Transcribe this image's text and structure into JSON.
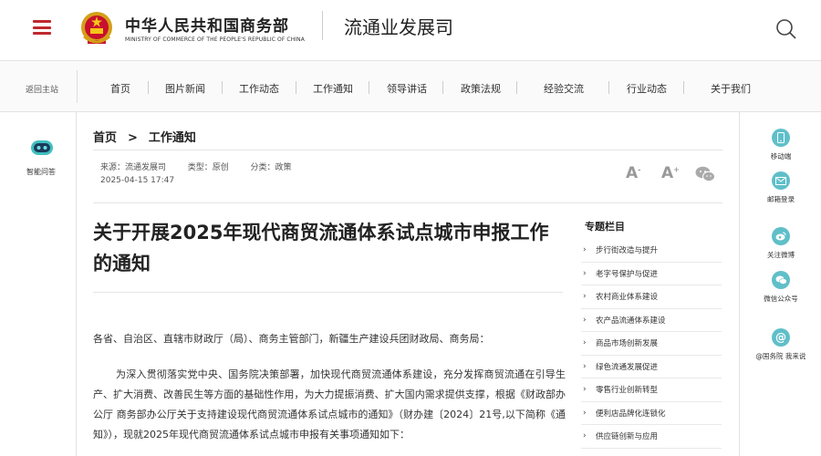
{
  "header": {
    "ministry_cn": "中华人民共和国商务部",
    "ministry_en": "MINISTRY OF COMMERCE OF THE PEOPLE'S REPUBLIC OF CHINA",
    "department": "流通业发展司",
    "icons": {
      "menu": "hamburger-menu-icon",
      "emblem": "national-emblem-icon",
      "search": "search-icon"
    },
    "accent_color": "#c0282e"
  },
  "nav": {
    "home": "返回主站",
    "items": [
      "首页",
      "图片新闻",
      "工作动态",
      "工作通知",
      "领导讲话",
      "政策法规",
      "经验交流",
      "行业动态",
      "关于我们"
    ]
  },
  "left_sidebar": {
    "assistant_label": "智能问答",
    "icon": "chat-bot-icon"
  },
  "right_sidebar": {
    "items": [
      {
        "label": "移动端",
        "icon": "mobile-icon"
      },
      {
        "label": "邮箱登录",
        "icon": "mail-icon"
      },
      {
        "label": "关注微博",
        "icon": "weibo-icon"
      },
      {
        "label": "微信公众号",
        "icon": "wechat-icon"
      },
      {
        "label": "@国务院 我来说",
        "icon": "at-icon"
      }
    ],
    "icon_color": "#5fbfc9"
  },
  "breadcrumb": {
    "home": "首页",
    "sep": ">",
    "current": "工作通知"
  },
  "meta": {
    "source": "来源：流通发展司",
    "type": "类型：原创",
    "category": "分类：政策",
    "date": "2025-04-15 17:47",
    "font_small": "A",
    "font_large": "A",
    "font_small_mark": "-",
    "font_large_mark": "+",
    "share_icon": "wechat-share-icon"
  },
  "article": {
    "title": "关于开展2025年现代商贸流通体系试点城市申报工作的通知",
    "salutation": "各省、自治区、直辖市财政厅（局）、商务主管部门，新疆生产建设兵团财政局、商务局：",
    "body": "为深入贯彻落实党中央、国务院决策部署，加快现代商贸流通体系建设，充分发挥商贸流通在引导生产、扩大消费、改善民生等方面的基础性作用，为大力提振消费、扩大国内需求提供支撑，根据《财政部办公厅 商务部办公厅关于支持建设现代商贸流通体系试点城市的通知》（财办建〔2024〕21号,以下简称《通知》），现就2025年现代商贸流通体系试点城市申报有关事项通知如下："
  },
  "columns": {
    "title": "专题栏目",
    "items": [
      "步行街改造与提升",
      "老字号保护与促进",
      "农村商业体系建设",
      "农产品流通体系建设",
      "商品市场创新发展",
      "绿色流通发展促进",
      "零售行业创新转型",
      "便利店品牌化连锁化",
      "供应链创新与应用"
    ]
  }
}
